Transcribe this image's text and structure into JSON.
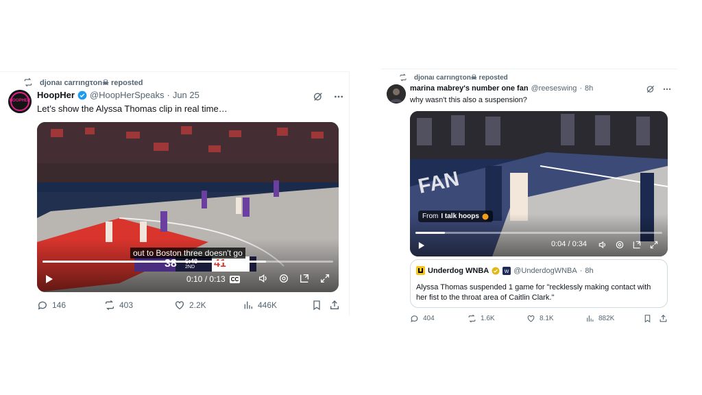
{
  "tweet1": {
    "repost_label": "djonaι carrιngτon☠ reposted",
    "author_name": "HoopHer",
    "handle": "@HoopHerSpeaks",
    "dot": "·",
    "date": "Jun 25",
    "text": "Let’s show the Alyssa Thomas clip in real time…",
    "avatar_text": "HOOPHER",
    "video": {
      "caption": "out to Boston three doesn't go",
      "score_left": "38",
      "score_right": "41",
      "game_clock": "6:48",
      "quarter": "2ND",
      "time": "0:10 / 0:13",
      "cc": "CC",
      "progress": 0.77
    },
    "actions": {
      "replies": "146",
      "reposts": "403",
      "likes": "2.2K",
      "views": "446K"
    }
  },
  "tweet2": {
    "repost_label": "djonaι carrιngτon☠ reposted",
    "author_name": "marina mabrey's number one fan",
    "handle": "@reeseswing",
    "dot": "·",
    "date": "8h",
    "text": "why wasn't this also a suspension?",
    "video": {
      "from_label": "From",
      "source_label": "I talk hoops",
      "time": "0:04 / 0:34",
      "court_text": "FAN",
      "progress": 0.12
    },
    "quote": {
      "author_name": "Underdog WNBA",
      "handle": "@UnderdogWNBA",
      "dot": "·",
      "date": "8h",
      "text_line1": "Alyssa Thomas suspended 1 game for \"recklessly making contact with",
      "text_line2": "her fist to the throat area of Caitlin Clark.\""
    },
    "actions": {
      "replies": "404",
      "reposts": "1.6K",
      "likes": "8.1K",
      "views": "882K"
    }
  },
  "colors": {
    "verified_blue": "#1d9bf0",
    "verified_gold": "#e2b719",
    "muted": "#536471",
    "text": "#0f1419",
    "hoopher_pink": "#e0218a"
  },
  "icons": [
    "repost-icon",
    "verified-badge-icon",
    "grok-icon",
    "more-icon",
    "play-icon",
    "volume-icon",
    "settings-icon",
    "pip-icon",
    "fullscreen-icon",
    "reply-icon",
    "like-icon",
    "views-icon",
    "bookmark-icon",
    "share-icon"
  ]
}
